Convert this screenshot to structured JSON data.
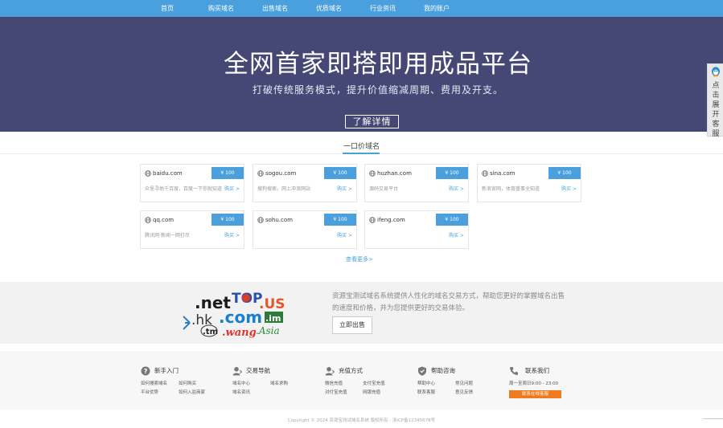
{
  "nav": {
    "items": [
      "首页",
      "购买域名",
      "出售域名",
      "优质域名",
      "行业资讯",
      "我的账户"
    ]
  },
  "hero": {
    "title": "全网首家即搭即用成品平台",
    "subtitle": "打破传统服务模式，提升价值缩减周期、费用及开支。",
    "button": "了解详情"
  },
  "section": {
    "title": "一口价域名"
  },
  "domains": [
    {
      "name": "baidu.com",
      "price": "¥ 100",
      "desc": "众里寻他千百度，百度一下你就知道",
      "buy": "购买 >"
    },
    {
      "name": "sogou.com",
      "price": "¥ 100",
      "desc": "搜狗搜索，网上冲浪网站",
      "buy": "购买 >"
    },
    {
      "name": "huzhan.com",
      "price": "¥ 100",
      "desc": "源码交易平台",
      "buy": "购买 >"
    },
    {
      "name": "sina.com",
      "price": "¥ 100",
      "desc": "新浪官网，体育盛事全知道",
      "buy": "购买 >"
    },
    {
      "name": "qq.com",
      "price": "¥ 100",
      "desc": "腾讯网·新闻一网打尽",
      "buy": "购买 >"
    },
    {
      "name": "sohu.com",
      "price": "¥ 100",
      "desc": "",
      "buy": "购买 >"
    },
    {
      "name": "ifeng.com",
      "price": "¥ 100",
      "desc": "",
      "buy": "购买 >"
    }
  ],
  "more_link": "查看更多>",
  "promo": {
    "logo_words": [
      ".net",
      "TOP",
      ".US",
      ".hk",
      ".com",
      ".im",
      ".tm",
      ".wang",
      ".Asia"
    ],
    "text": "资源宝测试域名系统提供人性化的域名交易方式，帮助您更好的掌握域名出售的速度和价格，并为您提供更好的交易体验。",
    "button": "立即出售"
  },
  "footer": {
    "columns": [
      {
        "title": "新手入门",
        "links": [
          "如何搜索域名",
          "如何购买",
          "平台优势",
          "如何入驻商家"
        ]
      },
      {
        "title": "交易导航",
        "links": [
          "域名中心",
          "域名求购",
          "域名资讯"
        ]
      },
      {
        "title": "充值方式",
        "links": [
          "微信充值",
          "支付宝充值",
          "对付宝充值",
          "网银充值"
        ]
      },
      {
        "title": "帮助咨询",
        "links": [
          "帮助中心",
          "常见问题",
          "联系客服",
          "意见反馈"
        ]
      },
      {
        "title": "联系我们",
        "hours": "周一至周日9:00 - 23:00",
        "service": "联系在线客服"
      }
    ],
    "copyright": "Copyright © 2024 资源宝测试域名系统 版权所有 · 浙ICP备12345678号"
  },
  "side": {
    "text": "点击展开客服"
  },
  "colors": {
    "nav": "#4aa0dc",
    "hero": "#454874",
    "accent": "#4aa0dc",
    "service": "#f07a1e"
  }
}
